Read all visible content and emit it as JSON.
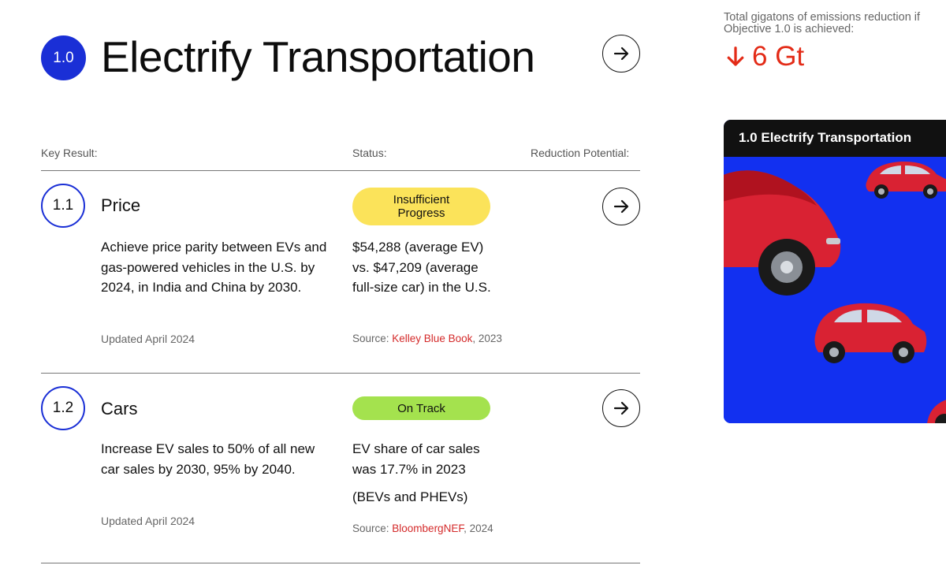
{
  "objective": {
    "number": "1.0",
    "title": "Electrify Transportation"
  },
  "columns": {
    "key_result": "Key Result:",
    "status": "Status:",
    "reduction": "Reduction Potential:"
  },
  "key_results": [
    {
      "number": "1.1",
      "title": "Price",
      "description": "Achieve price parity between EVs and gas-powered vehicles in the U.S. by 2024, in India and China by 2030.",
      "updated": "Updated April 2024",
      "status_badge": "Insufficient Progress",
      "status_color": "#fbe35a",
      "status_text": "$54,288 (average EV) vs. $47,209 (average full-size car) in the U.S.",
      "source_prefix": "Source: ",
      "source_link": "Kelley Blue Book",
      "source_suffix": ", 2023"
    },
    {
      "number": "1.2",
      "title": "Cars",
      "description": "Increase EV sales to 50% of all new car sales by 2030, 95% by 2040.",
      "updated": "Updated April 2024",
      "status_badge": "On Track",
      "status_color": "#a4e24e",
      "status_text": "EV share of car sales was 17.7% in 2023",
      "status_text_2": "(BEVs and PHEVs)",
      "source_prefix": "Source: ",
      "source_link": "BloombergNEF",
      "source_suffix": ", 2024"
    }
  ],
  "summary": {
    "caption": "Total gigatons of emissions reduction if Objective 1.0 is achieved:",
    "value": "6 Gt",
    "value_color": "#e32b17"
  },
  "card": {
    "title": "1.0 Electrify Transportation",
    "background": "#1230f0"
  },
  "icons": {
    "arrow": "arrow-right-icon",
    "down": "arrow-down-icon"
  }
}
